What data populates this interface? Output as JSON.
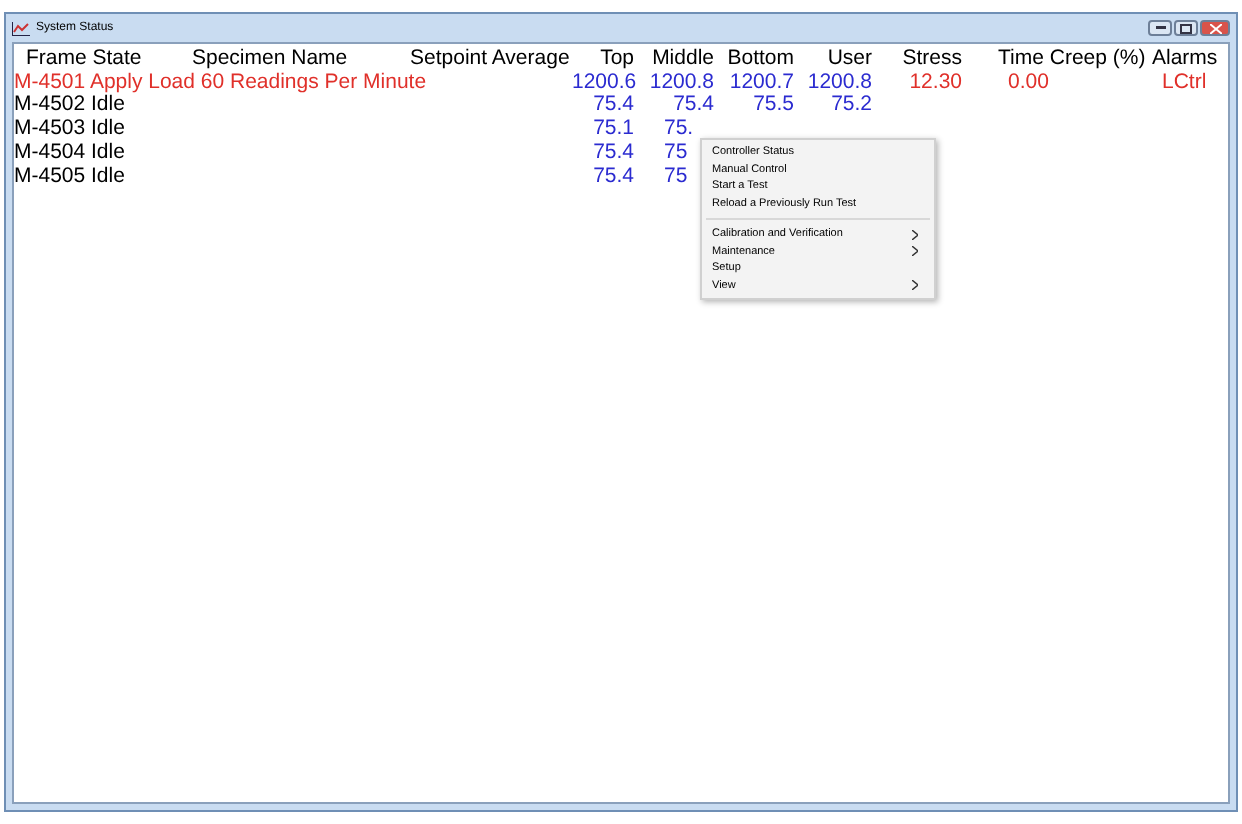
{
  "window": {
    "title": "System Status"
  },
  "table": {
    "columns": [
      "Frame State",
      "Specimen Name",
      "Setpoint Average",
      "Top",
      "Middle",
      "Bottom",
      "User",
      "Stress",
      "Time Creep (%)",
      "Alarms"
    ],
    "rows": [
      {
        "alarm": true,
        "state": "M-4501 Apply Load 60 Readings Per Minute",
        "values": [
          "1200.6",
          "1200.8",
          "1200.7",
          "1200.8"
        ],
        "stress": "12.30",
        "creep": "0.00",
        "alarm_text": "LCtrl"
      },
      {
        "alarm": false,
        "state": "M-4502 Idle",
        "values": [
          "75.4",
          "75.4",
          "75.5",
          "75.2"
        ]
      },
      {
        "alarm": false,
        "state": "M-4503 Idle",
        "values": [
          "75.1",
          "75."
        ]
      },
      {
        "alarm": false,
        "state": "M-4504 Idle",
        "values": [
          "75.4",
          "75"
        ]
      },
      {
        "alarm": false,
        "state": "M-4505 Idle",
        "values": [
          "75.4",
          "75"
        ]
      }
    ]
  },
  "context_menu": {
    "groups": [
      {
        "items": [
          {
            "label": "Controller Status",
            "submenu": false
          },
          {
            "label": "Manual Control",
            "submenu": false
          },
          {
            "label": "Start a Test",
            "submenu": false
          },
          {
            "label": "Reload a Previously Run Test",
            "submenu": false
          }
        ]
      },
      {
        "items": [
          {
            "label": "Calibration and Verification",
            "submenu": true
          },
          {
            "label": "Maintenance",
            "submenu": true
          },
          {
            "label": "Setup",
            "submenu": false
          },
          {
            "label": "View",
            "submenu": true
          }
        ]
      }
    ]
  }
}
